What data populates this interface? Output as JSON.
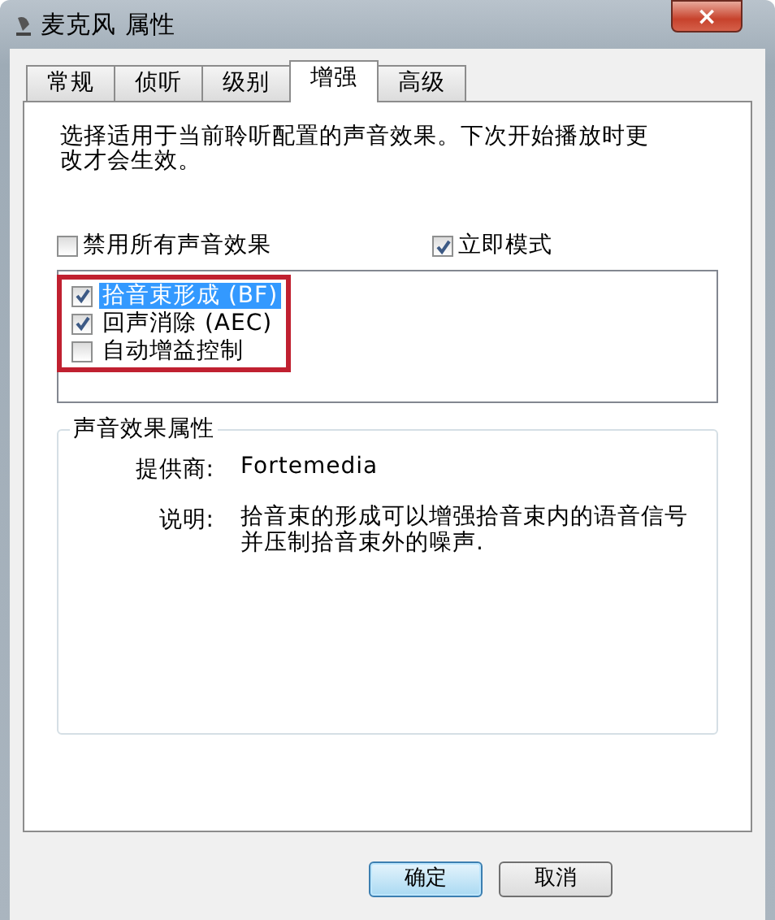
{
  "window": {
    "title": "麦克风 属性",
    "close": "×"
  },
  "tabs": [
    {
      "label": "常规",
      "selected": false
    },
    {
      "label": "侦听",
      "selected": false
    },
    {
      "label": "级别",
      "selected": false
    },
    {
      "label": "增强",
      "selected": true
    },
    {
      "label": "高级",
      "selected": false
    }
  ],
  "intro": "选择适用于当前聆听配置的声音效果。下次开始播放时更改才会生效。",
  "options": [
    {
      "label": "禁用所有声音效果",
      "checked": false
    },
    {
      "label": "立即模式",
      "checked": true
    }
  ],
  "effects": [
    {
      "label": "拾音束形成 (BF)",
      "checked": true,
      "selected": true
    },
    {
      "label": "回声消除 (AEC)",
      "checked": true,
      "selected": false
    },
    {
      "label": "自动增益控制",
      "checked": false,
      "selected": false
    }
  ],
  "properties": {
    "title": "声音效果属性",
    "provider_label": "提供商:",
    "provider": "Fortemedia",
    "description_label": "说明:",
    "description": "拾音束的形成可以增强拾音束内的语音信号并压制拾音束外的噪声."
  },
  "buttons": [
    {
      "label": "确定",
      "default": true
    },
    {
      "label": "取消",
      "default": false
    }
  ]
}
